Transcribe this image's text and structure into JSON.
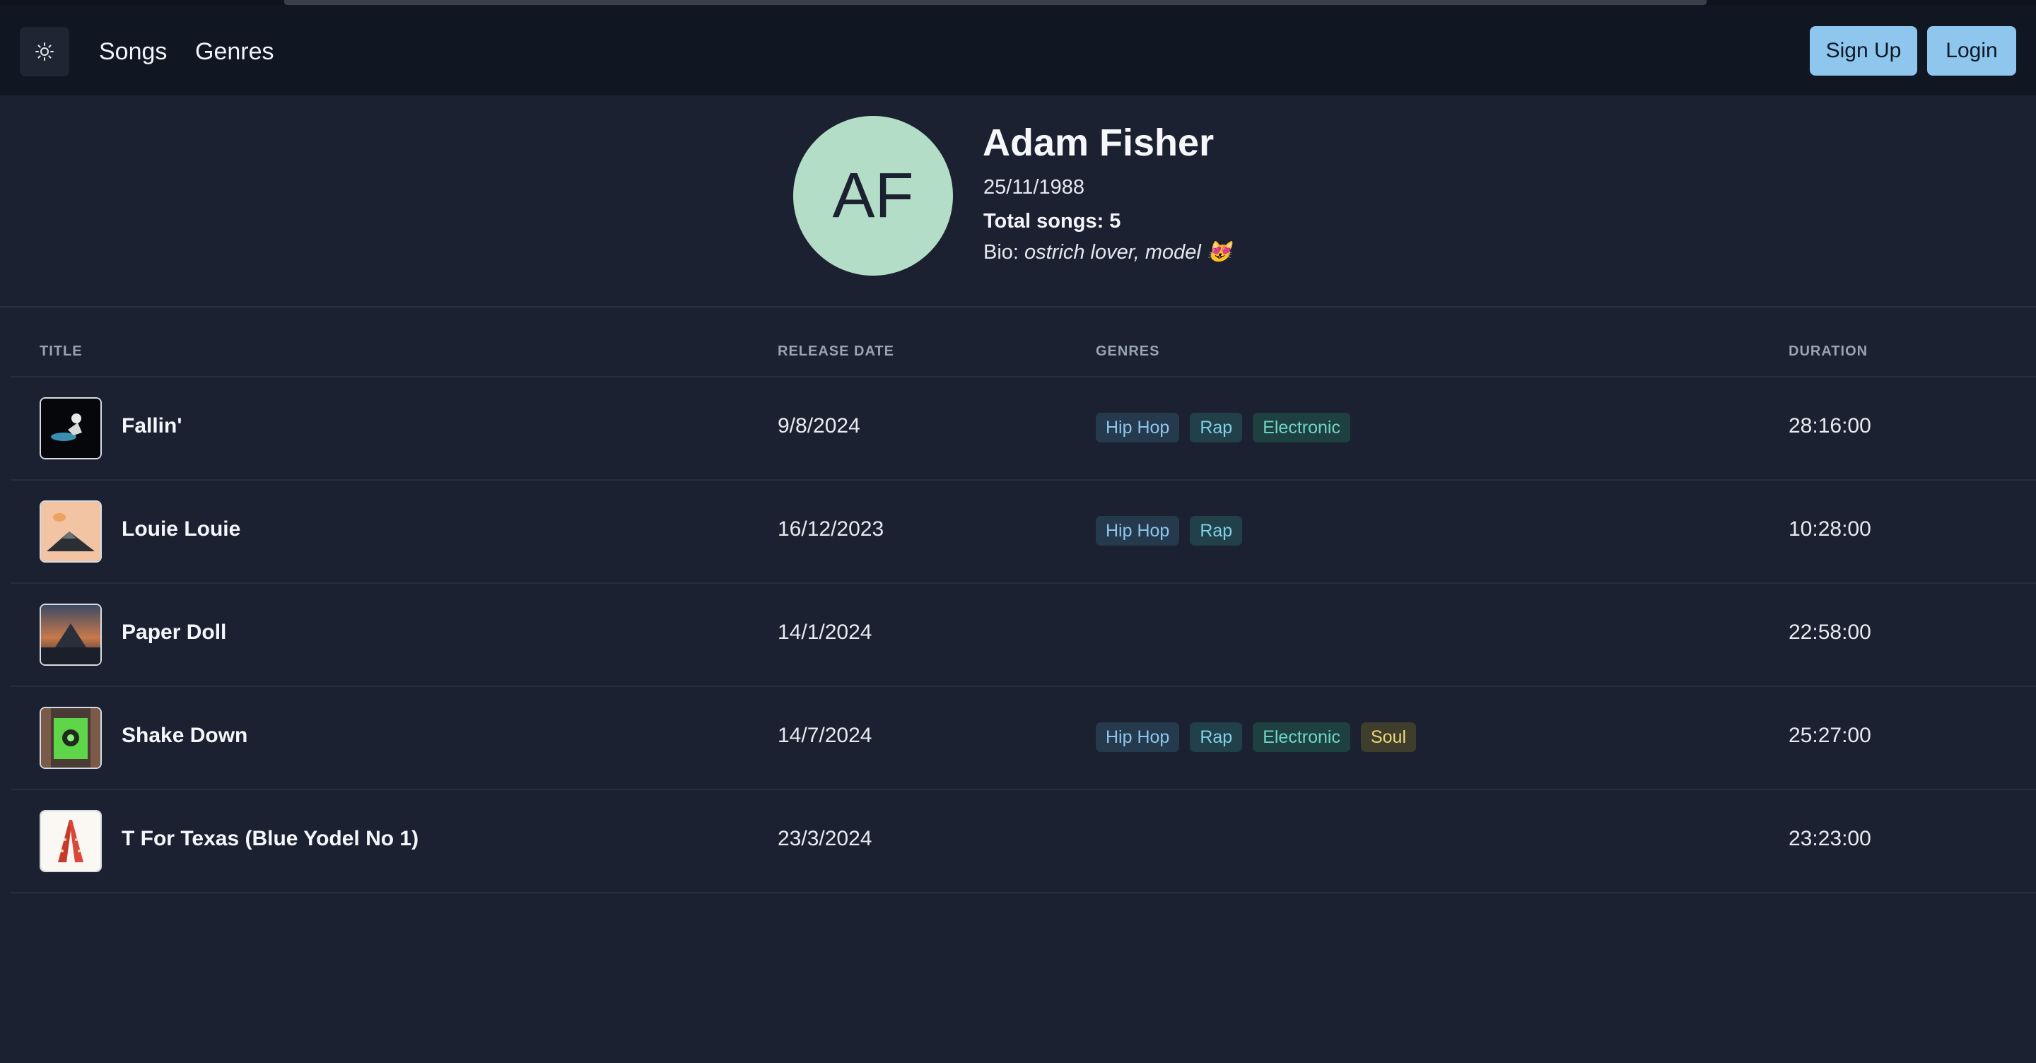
{
  "nav": {
    "theme_icon": "sun-icon",
    "links": [
      "Songs",
      "Genres"
    ],
    "signup_label": "Sign Up",
    "login_label": "Login"
  },
  "profile": {
    "initials": "AF",
    "name": "Adam Fisher",
    "birth_date": "25/11/1988",
    "total_songs": "Total songs: 5",
    "bio_label": "Bio:",
    "bio_text": "ostrich lover, model 😻"
  },
  "table": {
    "headers": {
      "title": "TITLE",
      "release_date": "RELEASE DATE",
      "genres": "GENRES",
      "duration": "DURATION"
    },
    "rows": [
      {
        "title": "Fallin'",
        "release_date": "9/8/2024",
        "genres": [
          "Hip Hop",
          "Rap",
          "Electronic"
        ],
        "duration": "28:16:00"
      },
      {
        "title": "Louie Louie",
        "release_date": "16/12/2023",
        "genres": [
          "Hip Hop",
          "Rap"
        ],
        "duration": "10:28:00"
      },
      {
        "title": "Paper Doll",
        "release_date": "14/1/2024",
        "genres": [],
        "duration": "22:58:00"
      },
      {
        "title": "Shake Down",
        "release_date": "14/7/2024",
        "genres": [
          "Hip Hop",
          "Rap",
          "Electronic",
          "Soul"
        ],
        "duration": "25:27:00"
      },
      {
        "title": "T For Texas (Blue Yodel No 1)",
        "release_date": "23/3/2024",
        "genres": [],
        "duration": "23:23:00"
      }
    ]
  },
  "colors": {
    "background": "#1b2130",
    "navbar": "#111722",
    "button": "#8ec6ee",
    "avatar": "#b4ddc7"
  }
}
